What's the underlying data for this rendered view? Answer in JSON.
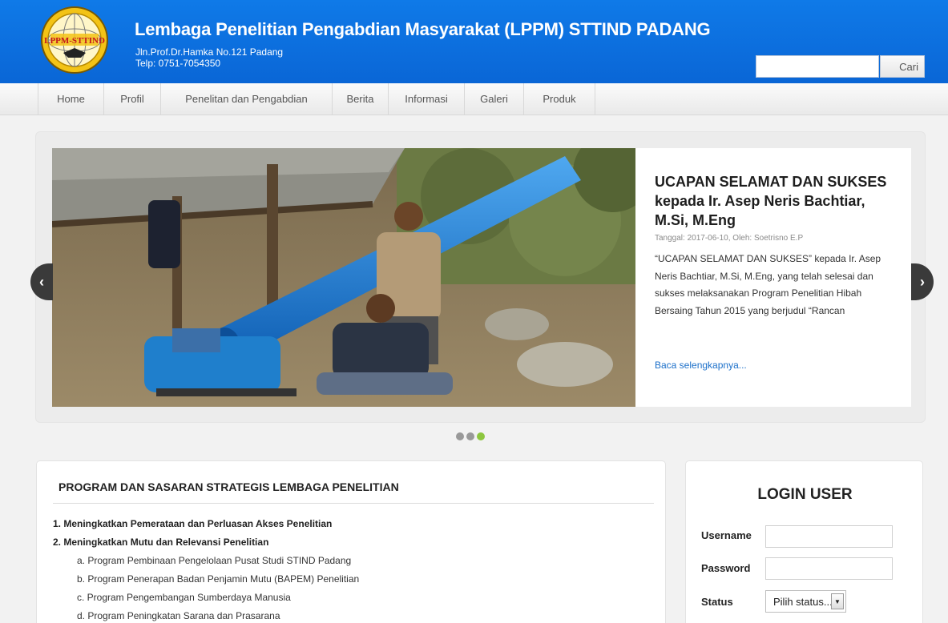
{
  "header": {
    "title": "Lembaga Penelitian Pengabdian Masyarakat (LPPM) STTIND PADANG",
    "address": "Jln.Prof.Dr.Hamka No.121 Padang",
    "phone": "Telp: 0751-7054350",
    "logo_text": "LPPM-STTIND",
    "search_placeholder": "",
    "search_button": "Cari"
  },
  "nav": {
    "items": [
      "Home",
      "Profil",
      "Penelitan dan Pengabdian",
      "Berita",
      "Informasi",
      "Galeri",
      "Produk"
    ]
  },
  "slider": {
    "title": "UCAPAN SELAMAT DAN SUKSES kepada Ir. Asep Neris Bachtiar, M.Si, M.Eng",
    "meta": "Tanggal: 2017-06-10, Oleh: Soetrisno E.P",
    "body": "“UCAPAN SELAMAT DAN SUKSES” kepada Ir. Asep Neris Bachtiar, M.Si, M.Eng, yang telah selesai dan sukses melaksanakan Program Penelitian Hibah Bersaing Tahun 2015 yang berjudul “Rancan",
    "read_more": "Baca selengkapnya...",
    "prev_icon": "‹",
    "next_icon": "›",
    "dots": 3,
    "active_dot": 2,
    "accent_color": "#8dc63f"
  },
  "program": {
    "title": "PROGRAM DAN SASARAN STRATEGIS LEMBAGA PENELITIAN",
    "items": [
      "1. Meningkatkan Pemerataan dan Perluasan Akses Penelitian",
      "2. Meningkatkan Mutu dan Relevansi Penelitian"
    ],
    "subitems": [
      "a. Program Pembinaan Pengelolaan Pusat Studi STIND Padang",
      "b. Program Penerapan Badan Penjamin Mutu (BAPEM) Penelitian",
      "c. Program Pengembangan Sumberdaya Manusia",
      "d. Program Peningkatan Sarana dan Prasarana"
    ]
  },
  "login": {
    "title": "LOGIN USER",
    "username_label": "Username",
    "password_label": "Password",
    "status_label": "Status",
    "status_value": "Pilih status...",
    "caret_icon": "▼"
  }
}
